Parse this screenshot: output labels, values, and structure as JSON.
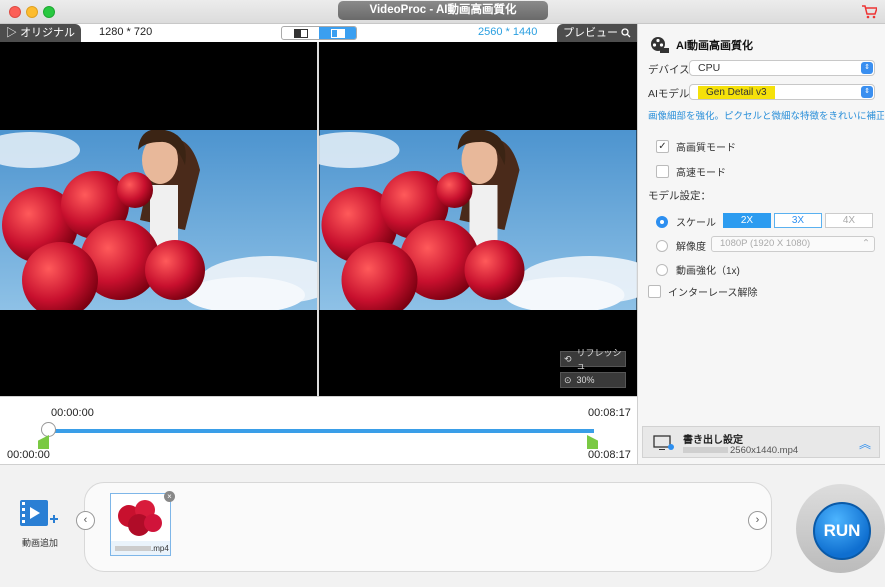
{
  "window": {
    "title": "VideoProc - AI動画高画質化"
  },
  "preview": {
    "original_label": "オリジナル",
    "original_res": "1280 * 720",
    "preview_label": "プレビュー",
    "preview_res": "2560 * 1440",
    "refresh_label": "リフレッシュ",
    "zoom_label": "30%"
  },
  "timeline": {
    "top_left": "00:00:00",
    "top_right": "00:08:17",
    "bottom_left": "00:00:00",
    "bottom_right": "00:08:17"
  },
  "panel": {
    "title": "AI動画高画質化",
    "device_label": "デバイス:",
    "device_value": "CPU",
    "model_label": "AIモデル:",
    "model_value": "Gen Detail v3",
    "description": "画像細部を強化。ピクセルと微細な特徴をきれいに補正！ピ",
    "hq_mode": "高画質モード",
    "fast_mode": "高速モード",
    "model_settings": "モデル設定：",
    "scale_label": "スケール",
    "scale_options": [
      "2X",
      "3X",
      "4X"
    ],
    "resolution_label": "解像度",
    "resolution_value": "1080P (1920 X 1080)",
    "enhance_label": "動画強化（1x)",
    "deinterlace_label": "インターレース解除",
    "export_title": "書き出し設定",
    "export_file": "2560x1440.mp4"
  },
  "bottom": {
    "add_video": "動画追加",
    "thumb_file": ".mp4",
    "run": "RUN"
  },
  "colors": {
    "accent": "#2d9cf0",
    "model_badge": "#f5e10a"
  }
}
